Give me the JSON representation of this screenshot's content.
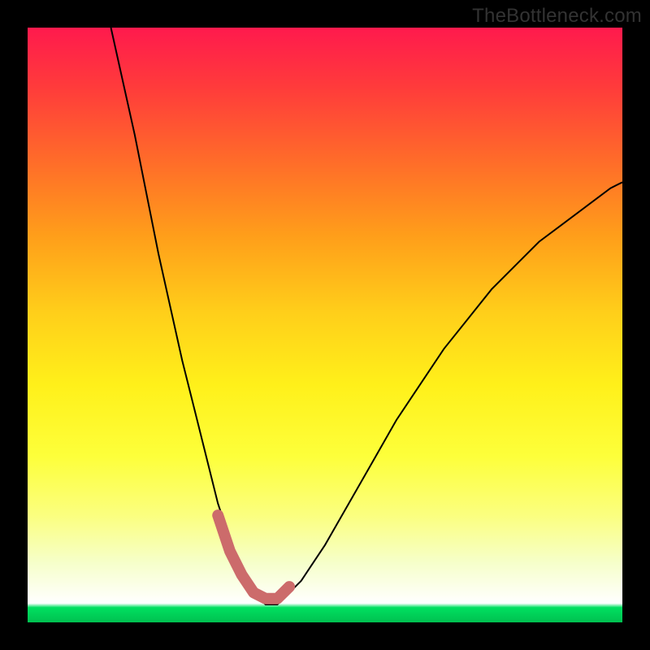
{
  "watermark": "TheBottleneck.com",
  "chart_data": {
    "type": "line",
    "title": "",
    "xlabel": "",
    "ylabel": "",
    "xlim": [
      0,
      100
    ],
    "ylim": [
      0,
      100
    ],
    "grid": false,
    "series": [
      {
        "name": "bottleneck-curve",
        "x": [
          14,
          18,
          22,
          26,
          28,
          30,
          32,
          34,
          36,
          38,
          40,
          42,
          46,
          50,
          54,
          58,
          62,
          66,
          70,
          74,
          78,
          82,
          86,
          90,
          94,
          98,
          100
        ],
        "y": [
          100,
          82,
          62,
          44,
          36,
          28,
          20,
          14,
          9,
          5,
          3,
          3,
          7,
          13,
          20,
          27,
          34,
          40,
          46,
          51,
          56,
          60,
          64,
          67,
          70,
          73,
          74
        ]
      }
    ],
    "annotations": [
      {
        "name": "optimal-range-marker",
        "type": "highlight-segment",
        "x": [
          32,
          34,
          36,
          38,
          40,
          42,
          44
        ],
        "y": [
          18,
          12,
          8,
          5,
          4,
          4,
          6
        ],
        "color": "#cc6b6b"
      }
    ],
    "background": {
      "type": "vertical-gradient",
      "stops": [
        {
          "pos": 0,
          "color": "#ff1a4d"
        },
        {
          "pos": 50,
          "color": "#ffe01a"
        },
        {
          "pos": 95,
          "color": "#ffffff"
        },
        {
          "pos": 100,
          "color": "#00c050"
        }
      ]
    }
  }
}
